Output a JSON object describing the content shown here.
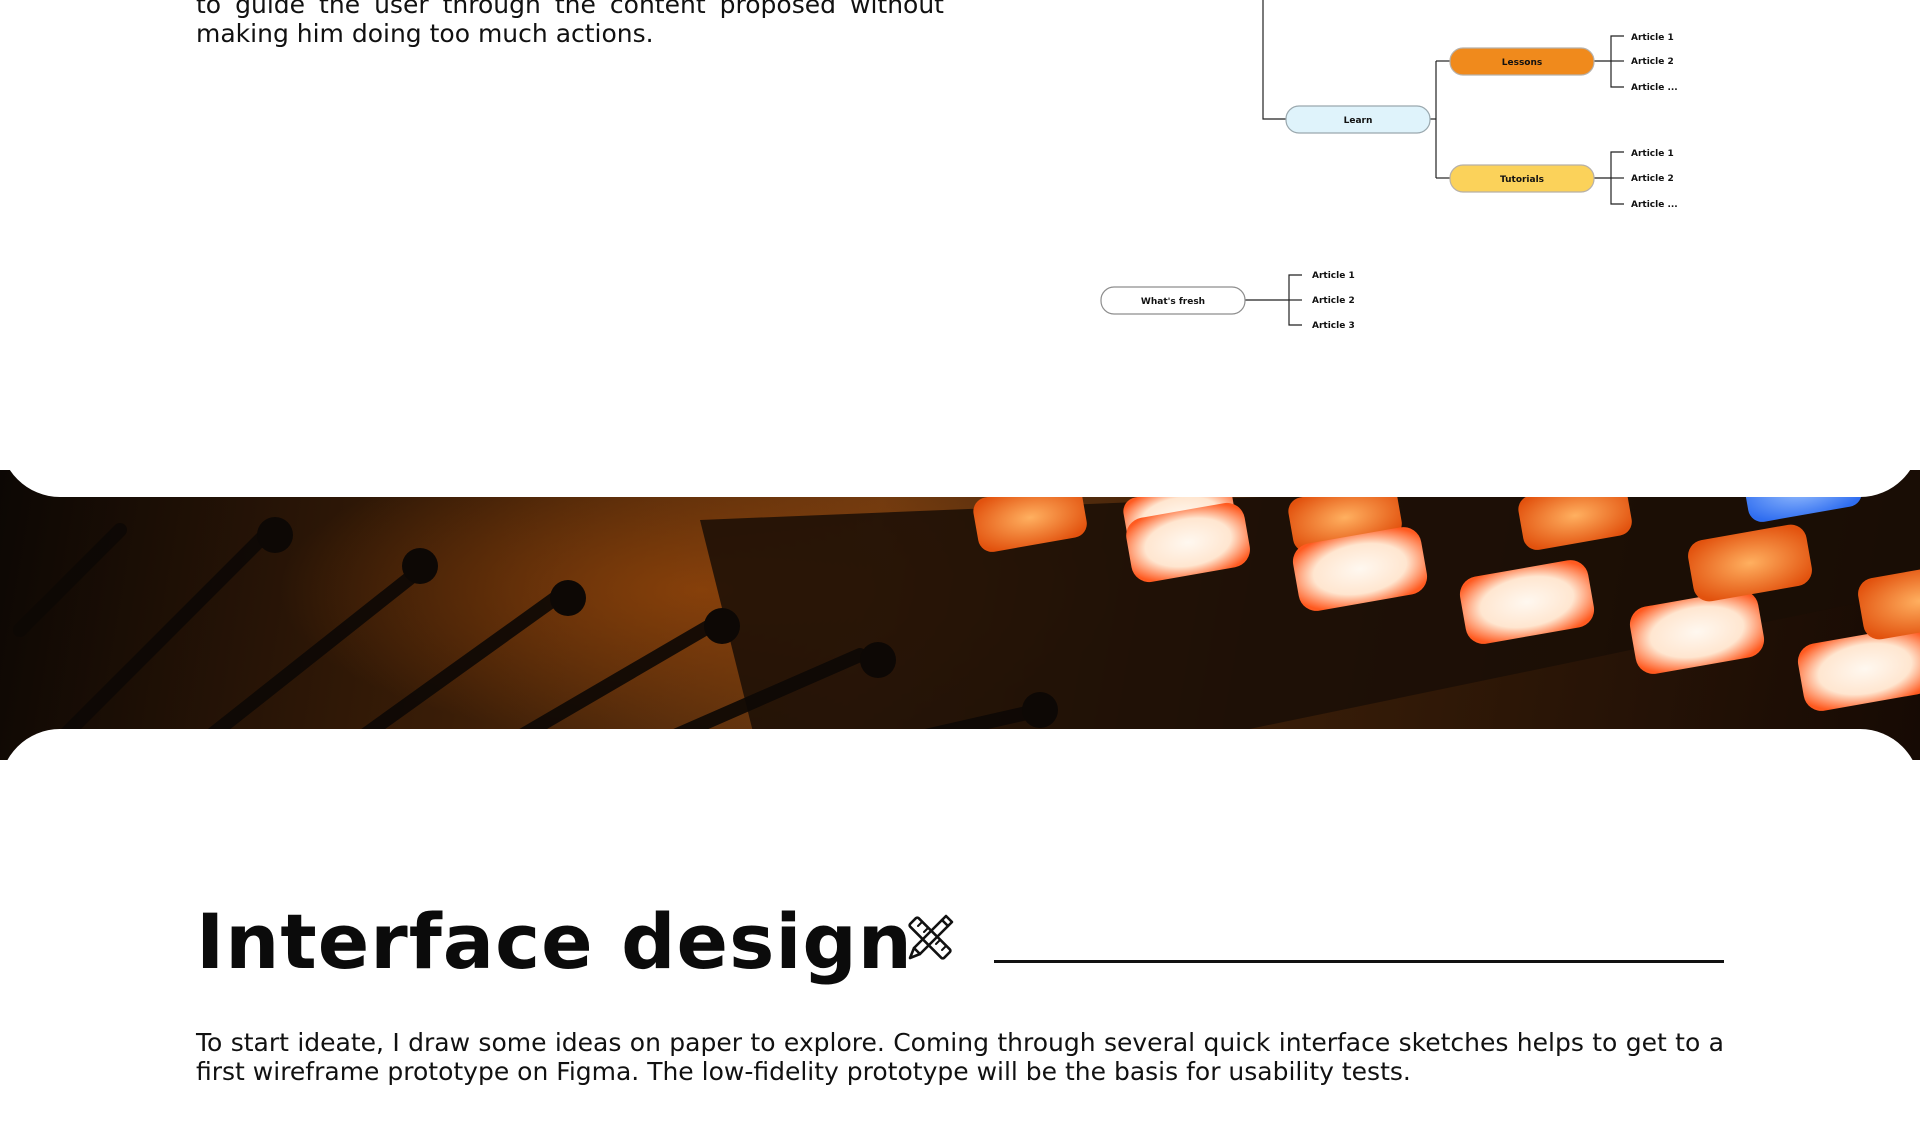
{
  "intro": {
    "text": "to guide the user through the content proposed without making him doing too much actions."
  },
  "sitemap": {
    "learn": "Learn",
    "lessons": "Lessons",
    "tutorials": "Tutorials",
    "whats_fresh": "What's fresh",
    "lessons_articles": [
      "Article 1",
      "Article 2",
      "Article ..."
    ],
    "tutorials_articles": [
      "Article 1",
      "Article 2",
      "Article ..."
    ],
    "fresh_articles": [
      "Article 1",
      "Article 2",
      "Article 3"
    ],
    "colors": {
      "learn": "#dff3fb",
      "lessons": "#f08a1c",
      "tutorials": "#fbd25a",
      "whats_fresh": "#ffffff"
    }
  },
  "section": {
    "title": "Interface design",
    "icon": "pencil-ruler-icon",
    "body": "To start ideate, I draw some ideas on paper to explore. Coming through several quick interface sketches helps to get to a first wireframe prototype on Figma. The low-fidelity prototype will be the basis for usability tests."
  }
}
